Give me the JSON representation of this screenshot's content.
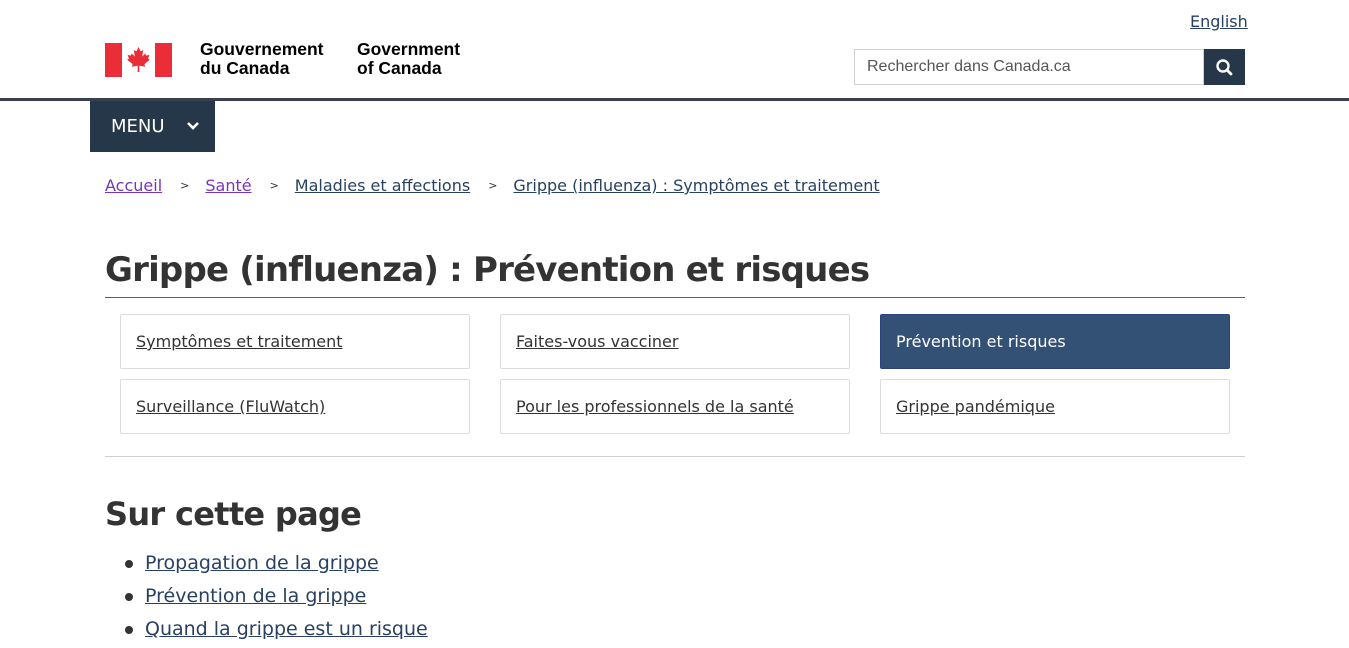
{
  "header": {
    "language_toggle": "English",
    "signature_fr": [
      "Gouvernement",
      "du Canada"
    ],
    "signature_en": [
      "Government",
      "of Canada"
    ],
    "search": {
      "placeholder": "Rechercher dans Canada.ca",
      "button_icon": "search-icon"
    },
    "flag_icon": "canada-flag-icon",
    "colors": {
      "primary": "#26374a",
      "accent": "#af3c43",
      "link": "#284162",
      "visited": "#7834bc"
    }
  },
  "menu": {
    "label": "MENU",
    "icon": "chevron-down-icon"
  },
  "breadcrumb": {
    "separator": ">",
    "items": [
      "Accueil",
      "Santé",
      "Maladies et affections",
      "Grippe (influenza) : Symptômes et traitement"
    ]
  },
  "page": {
    "title": "Grippe (influenza) : Prévention et risques",
    "tiles": [
      {
        "label": "Symptômes et traitement",
        "active": false
      },
      {
        "label": "Faites-vous vacciner",
        "active": false
      },
      {
        "label": "Prévention et risques",
        "active": true
      },
      {
        "label": "Surveillance (FluWatch)",
        "active": false
      },
      {
        "label": "Pour les professionnels de la santé",
        "active": false
      },
      {
        "label": "Grippe pandémique",
        "active": false
      }
    ],
    "toc_heading": "Sur cette page",
    "toc": [
      "Propagation de la grippe",
      "Prévention de la grippe",
      "Quand la grippe est un risque"
    ]
  }
}
